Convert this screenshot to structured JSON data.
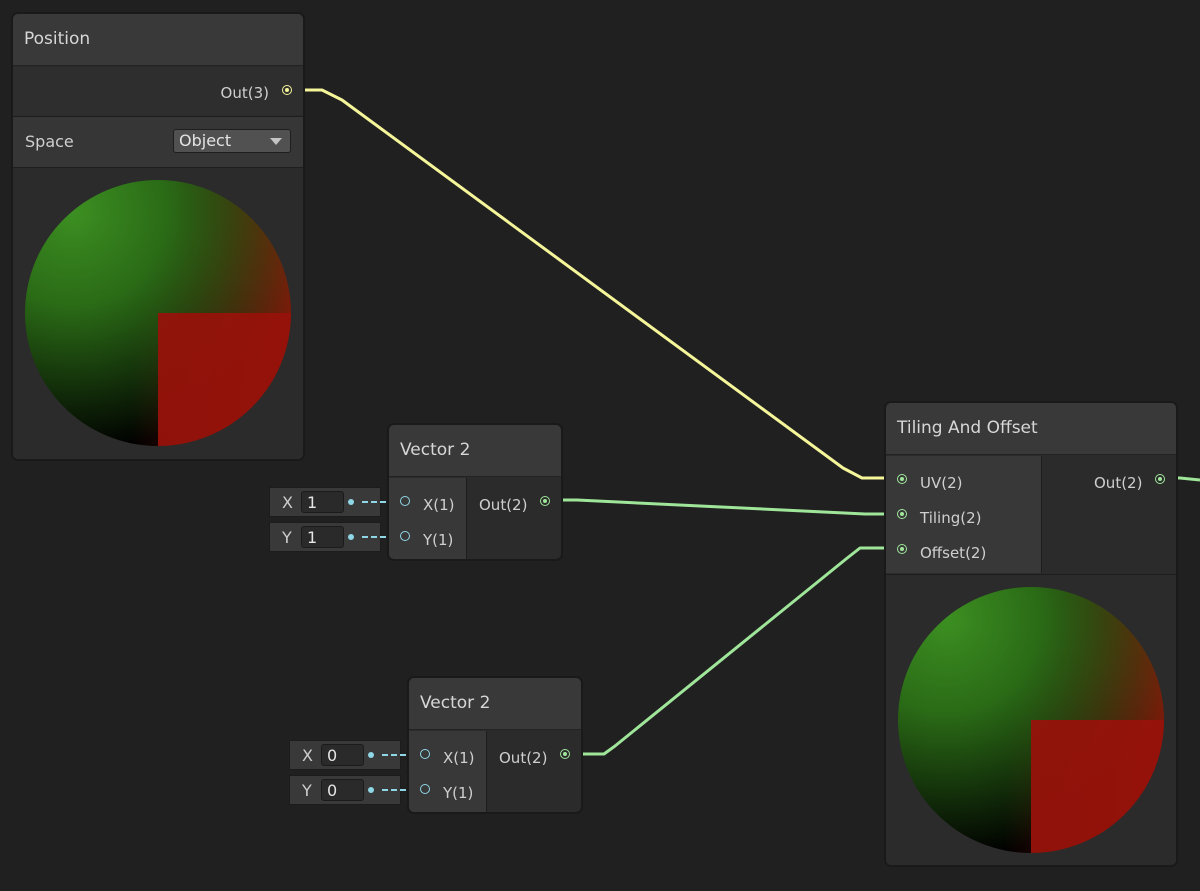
{
  "colors": {
    "vector3_wire": "#f5f59a",
    "vector2_wire": "#9fe69a",
    "vector1_port": "#8fd7e6",
    "background": "#202020"
  },
  "nodes": {
    "position": {
      "title": "Position",
      "output": "Out(3)",
      "space_label": "Space",
      "space_value": "Object"
    },
    "vector2_a": {
      "title": "Vector 2",
      "input_x": "X(1)",
      "input_y": "Y(1)",
      "output": "Out(2)",
      "field_x_axis": "X",
      "field_x_value": "1",
      "field_y_axis": "Y",
      "field_y_value": "1"
    },
    "vector2_b": {
      "title": "Vector 2",
      "input_x": "X(1)",
      "input_y": "Y(1)",
      "output": "Out(2)",
      "field_x_axis": "X",
      "field_x_value": "0",
      "field_y_axis": "Y",
      "field_y_value": "0"
    },
    "tiling_offset": {
      "title": "Tiling And Offset",
      "input_uv": "UV(2)",
      "input_tiling": "Tiling(2)",
      "input_offset": "Offset(2)",
      "output": "Out(2)"
    }
  }
}
